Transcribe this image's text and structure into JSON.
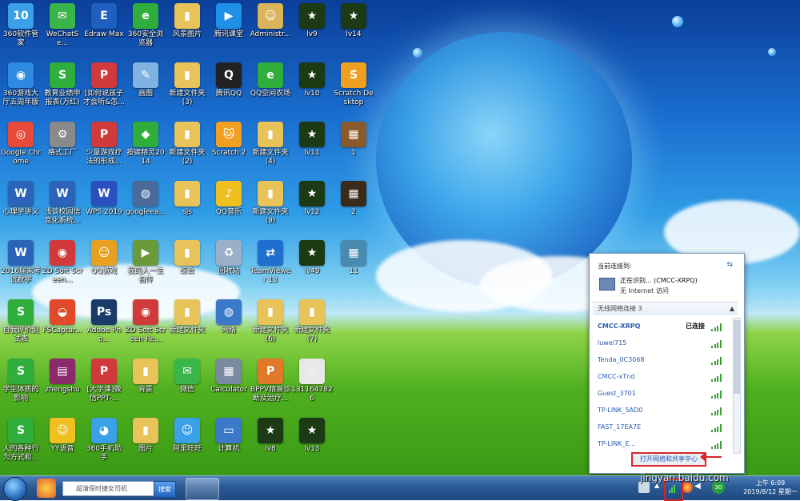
{
  "desktop": {
    "icons": [
      {
        "label": "360软件管家",
        "color": "#3aa0e8",
        "glyph": "10",
        "col": 0,
        "row": 0
      },
      {
        "label": "WeChatSe...",
        "color": "#39b54a",
        "glyph": "✉",
        "col": 1,
        "row": 0
      },
      {
        "label": "Edraw Max",
        "color": "#1f5fbf",
        "glyph": "E",
        "col": 2,
        "row": 0
      },
      {
        "label": "360安全浏览器",
        "color": "#2fae3c",
        "glyph": "e",
        "col": 3,
        "row": 0
      },
      {
        "label": "风景图片",
        "color": "#e8c35a",
        "glyph": "▮",
        "col": 4,
        "row": 0
      },
      {
        "label": "腾讯课堂",
        "color": "#1f8fe8",
        "glyph": "▶",
        "col": 5,
        "row": 0
      },
      {
        "label": "Administr...",
        "color": "#d9b45a",
        "glyph": "☺",
        "col": 6,
        "row": 0
      },
      {
        "label": "lv9",
        "color": "#1c3a14",
        "glyph": "★",
        "col": 7,
        "row": 0
      },
      {
        "label": "lv14",
        "color": "#1c3a14",
        "glyph": "★",
        "col": 8,
        "row": 0
      },
      {
        "label": "360游戏大厅五周年版",
        "color": "#2d8ae0",
        "glyph": "◉",
        "col": 0,
        "row": 1
      },
      {
        "label": "教育业绩申报表(万红)",
        "color": "#2fae3c",
        "glyph": "S",
        "col": 1,
        "row": 1
      },
      {
        "label": "[如何说孩子才会听&怎...",
        "color": "#d13a3a",
        "glyph": "P",
        "col": 2,
        "row": 1
      },
      {
        "label": "画图",
        "color": "#7fb2e0",
        "glyph": "✎",
        "col": 3,
        "row": 1
      },
      {
        "label": "新建文件夹(3)",
        "color": "#e8c35a",
        "glyph": "▮",
        "col": 4,
        "row": 1
      },
      {
        "label": "腾讯QQ",
        "color": "#222",
        "glyph": "Q",
        "col": 5,
        "row": 1
      },
      {
        "label": "QQ空间农场",
        "color": "#2fae3c",
        "glyph": "e",
        "col": 6,
        "row": 1
      },
      {
        "label": "lv10",
        "color": "#1c3a14",
        "glyph": "★",
        "col": 7,
        "row": 1
      },
      {
        "label": "Scratch Desktop",
        "color": "#f0a020",
        "glyph": "S",
        "col": 8,
        "row": 1
      },
      {
        "label": "Google Chrome",
        "color": "#e84a3a",
        "glyph": "◎",
        "col": 0,
        "row": 2
      },
      {
        "label": "格式工厂",
        "color": "#8a8a8a",
        "glyph": "⚙",
        "col": 1,
        "row": 2
      },
      {
        "label": "少量游戏疗法的形成...",
        "color": "#d13a3a",
        "glyph": "P",
        "col": 2,
        "row": 2
      },
      {
        "label": "按键精灵2014",
        "color": "#2fae3c",
        "glyph": "◆",
        "col": 3,
        "row": 2
      },
      {
        "label": "新建文件夹(2)",
        "color": "#e8c35a",
        "glyph": "▮",
        "col": 4,
        "row": 2
      },
      {
        "label": "Scratch 2",
        "color": "#f0a020",
        "glyph": "🐱",
        "col": 5,
        "row": 2
      },
      {
        "label": "新建文件夹(4)",
        "color": "#e8c35a",
        "glyph": "▮",
        "col": 6,
        "row": 2
      },
      {
        "label": "lv11",
        "color": "#1c3a14",
        "glyph": "★",
        "col": 7,
        "row": 2
      },
      {
        "label": "1",
        "color": "#8a5a2a",
        "glyph": "▦",
        "col": 8,
        "row": 2
      },
      {
        "label": "心理学讲义",
        "color": "#2a63b8",
        "glyph": "W",
        "col": 0,
        "row": 3
      },
      {
        "label": "浅谈校园信息化系统...",
        "color": "#2a63b8",
        "glyph": "W",
        "col": 1,
        "row": 3
      },
      {
        "label": "WPS 2019",
        "color": "#2a4fbf",
        "glyph": "W",
        "col": 2,
        "row": 3
      },
      {
        "label": "googleea...",
        "color": "#4a6a9a",
        "glyph": "◍",
        "col": 3,
        "row": 3
      },
      {
        "label": "sjs",
        "color": "#e8c35a",
        "glyph": "▮",
        "col": 4,
        "row": 3
      },
      {
        "label": "QQ音乐",
        "color": "#f0c020",
        "glyph": "♪",
        "col": 5,
        "row": 3
      },
      {
        "label": "新建文件夹(9)",
        "color": "#e8c35a",
        "glyph": "▮",
        "col": 6,
        "row": 3
      },
      {
        "label": "lv12",
        "color": "#1c3a14",
        "glyph": "★",
        "col": 7,
        "row": 3
      },
      {
        "label": "2",
        "color": "#3a2a1a",
        "glyph": "▦",
        "col": 8,
        "row": 3
      },
      {
        "label": "2016届末考试数学",
        "color": "#2a63b8",
        "glyph": "W",
        "col": 0,
        "row": 4
      },
      {
        "label": "ZD Soft Screen...",
        "color": "#d13a3a",
        "glyph": "◉",
        "col": 1,
        "row": 4
      },
      {
        "label": "QQ游戏",
        "color": "#e8a020",
        "glyph": "☺",
        "col": 2,
        "row": 4
      },
      {
        "label": "我的人一生自传",
        "color": "#6a9a3a",
        "glyph": "▶",
        "col": 3,
        "row": 4
      },
      {
        "label": "综合",
        "color": "#e8c35a",
        "glyph": "▮",
        "col": 4,
        "row": 4
      },
      {
        "label": "回收站",
        "color": "#9ab0c8",
        "glyph": "♻",
        "col": 5,
        "row": 4
      },
      {
        "label": "TeamViewer 13",
        "color": "#1f6fd0",
        "glyph": "⇄",
        "col": 6,
        "row": 4
      },
      {
        "label": "lv49",
        "color": "#1c3a14",
        "glyph": "★",
        "col": 7,
        "row": 4
      },
      {
        "label": "11",
        "color": "#4a8ab0",
        "glyph": "▦",
        "col": 8,
        "row": 4
      },
      {
        "label": "自我评价测试表",
        "color": "#2fae3c",
        "glyph": "S",
        "col": 0,
        "row": 5
      },
      {
        "label": "FSCaptur...",
        "color": "#e04a2a",
        "glyph": "◒",
        "col": 1,
        "row": 5
      },
      {
        "label": "Adobe Pho...",
        "color": "#1a3a6a",
        "glyph": "Ps",
        "col": 2,
        "row": 5
      },
      {
        "label": "ZD Soft Screen Re...",
        "color": "#d13a3a",
        "glyph": "◉",
        "col": 3,
        "row": 5
      },
      {
        "label": "新建文件夹",
        "color": "#e8c35a",
        "glyph": "▮",
        "col": 4,
        "row": 5
      },
      {
        "label": "网络",
        "color": "#3a7ac8",
        "glyph": "◍",
        "col": 5,
        "row": 5
      },
      {
        "label": "新建文件夹(6)",
        "color": "#e8c35a",
        "glyph": "▮",
        "col": 6,
        "row": 5
      },
      {
        "label": "新建文件夹(7)",
        "color": "#e8c35a",
        "glyph": "▮",
        "col": 7,
        "row": 5
      },
      {
        "label": "学生体质的影响",
        "color": "#2fae3c",
        "glyph": "S",
        "col": 0,
        "row": 6
      },
      {
        "label": "zhengshu",
        "color": "#8a2a6a",
        "glyph": "▤",
        "col": 1,
        "row": 6
      },
      {
        "label": "[大学课]微信PPT-...",
        "color": "#d13a3a",
        "glyph": "P",
        "col": 2,
        "row": 6
      },
      {
        "label": "背景",
        "color": "#e8c35a",
        "glyph": "▮",
        "col": 3,
        "row": 6
      },
      {
        "label": "微信",
        "color": "#39b54a",
        "glyph": "✉",
        "col": 4,
        "row": 6
      },
      {
        "label": "Calculator",
        "color": "#7a8aa0",
        "glyph": "▦",
        "col": 5,
        "row": 6
      },
      {
        "label": "BPPV精准诊断及治疗...",
        "color": "#e07a2a",
        "glyph": "P",
        "col": 6,
        "row": 6
      },
      {
        "label": "1311647826",
        "color": "#e8e8e8",
        "glyph": "▯",
        "col": 7,
        "row": 6
      },
      {
        "label": "人的各种行为方式和...",
        "color": "#2fae3c",
        "glyph": "S",
        "col": 0,
        "row": 7
      },
      {
        "label": "YY语音",
        "color": "#f0c020",
        "glyph": "☺",
        "col": 1,
        "row": 7
      },
      {
        "label": "360手机助手",
        "color": "#3aa0e8",
        "glyph": "◕",
        "col": 2,
        "row": 7
      },
      {
        "label": "图片",
        "color": "#e8c35a",
        "glyph": "▮",
        "col": 3,
        "row": 7
      },
      {
        "label": "阿里旺旺",
        "color": "#3aa0e8",
        "glyph": "☺",
        "col": 4,
        "row": 7
      },
      {
        "label": "计算机",
        "color": "#3a7ac8",
        "glyph": "▭",
        "col": 5,
        "row": 7
      },
      {
        "label": "lv8",
        "color": "#1c3a14",
        "glyph": "★",
        "col": 6,
        "row": 7
      },
      {
        "label": "lv13",
        "color": "#1c3a14",
        "glyph": "★",
        "col": 7,
        "row": 7
      }
    ]
  },
  "wifi": {
    "current_label": "当前连接到:",
    "current_name": "正在识别... (CMCC-XRPQ)",
    "current_status": "无 Internet 访问",
    "section_label": "无线网络连接 3",
    "networks": [
      {
        "name": "CMCC-XRPQ",
        "status": "已连接"
      },
      {
        "name": "luwei715",
        "status": ""
      },
      {
        "name": "Tenda_0C3068",
        "status": ""
      },
      {
        "name": "CMCC-xTnd",
        "status": ""
      },
      {
        "name": "Guest_3701",
        "status": ""
      },
      {
        "name": "TP-LINK_5AD0",
        "status": ""
      },
      {
        "name": "FAST_17EA7E",
        "status": ""
      },
      {
        "name": "TP-LINK_E...",
        "status": ""
      }
    ],
    "open_center_label": "打开网络和共享中心"
  },
  "taskbar": {
    "search_placeholder": "超清保时捷女司机",
    "search_button": "搜索",
    "clock_time": "上午 6:09",
    "clock_date": "2019/8/12 星期一",
    "tray_badge": "30"
  },
  "watermark": "jingyan.baidu.com",
  "colors": {
    "accent": "#2a5bb0",
    "signal": "#3aa233",
    "highlight": "#d62828"
  }
}
